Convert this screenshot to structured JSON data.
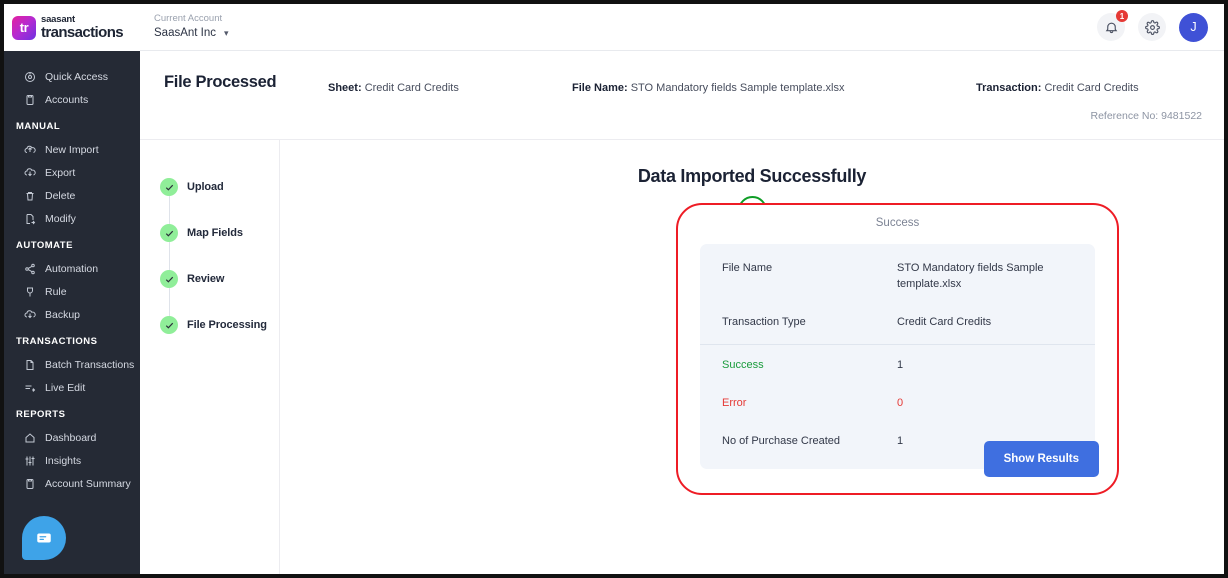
{
  "brand": {
    "mark_text": "tr",
    "name_top": "saasant",
    "name_bottom": "transactions",
    "mark_gradient_from": "#e5219e",
    "mark_gradient_to": "#6c31e0"
  },
  "topbar": {
    "account_label": "Current Account",
    "account_name": "SaasAnt Inc",
    "notification_count": "1",
    "avatar_initial": "J"
  },
  "sidebar": {
    "top_items": [
      {
        "label": "Quick Access",
        "icon": "target-icon"
      },
      {
        "label": "Accounts",
        "icon": "clipboard-icon"
      }
    ],
    "sections": [
      {
        "title": "MANUAL",
        "items": [
          {
            "label": "New Import",
            "icon": "upload-cloud-icon"
          },
          {
            "label": "Export",
            "icon": "download-cloud-icon"
          },
          {
            "label": "Delete",
            "icon": "trash-icon"
          },
          {
            "label": "Modify",
            "icon": "file-edit-icon"
          }
        ]
      },
      {
        "title": "AUTOMATE",
        "items": [
          {
            "label": "Automation",
            "icon": "share-nodes-icon"
          },
          {
            "label": "Rule",
            "icon": "rule-icon"
          },
          {
            "label": "Backup",
            "icon": "backup-cloud-icon"
          }
        ]
      },
      {
        "title": "TRANSACTIONS",
        "items": [
          {
            "label": "Batch Transactions",
            "icon": "document-icon"
          },
          {
            "label": "Live Edit",
            "icon": "live-edit-icon"
          }
        ]
      },
      {
        "title": "REPORTS",
        "items": [
          {
            "label": "Dashboard",
            "icon": "home-icon"
          },
          {
            "label": "Insights",
            "icon": "sliders-icon"
          },
          {
            "label": "Account Summary",
            "icon": "clipboard-icon"
          }
        ]
      }
    ],
    "chat_icon": "chat-bubble-icon"
  },
  "page_header": {
    "title": "File Processed",
    "sheet_label": "Sheet:",
    "sheet_value": "Credit Card Credits",
    "file_label": "File Name:",
    "file_value": "STO Mandatory fields Sample template.xlsx",
    "transaction_label": "Transaction:",
    "transaction_value": "Credit Card Credits",
    "reference": "Reference No: 9481522"
  },
  "stepper": {
    "steps": [
      {
        "label": "Upload",
        "state": "complete"
      },
      {
        "label": "Map Fields",
        "state": "complete"
      },
      {
        "label": "Review",
        "state": "complete"
      },
      {
        "label": "File Processing",
        "state": "complete"
      }
    ]
  },
  "result": {
    "heading": "Data Imported Successfully",
    "status_icon": "check-circle-icon",
    "panel_label": "Success",
    "rows": [
      {
        "key": "File Name",
        "value": "STO Mandatory fields Sample template.xlsx",
        "tone": "default"
      },
      {
        "key": "Transaction Type",
        "value": "Credit Card Credits",
        "tone": "default"
      },
      {
        "key": "Success",
        "value": "1",
        "tone": "green"
      },
      {
        "key": "Error",
        "value": "0",
        "tone": "red"
      },
      {
        "key": "No of Purchase Created",
        "value": "1",
        "tone": "default"
      }
    ],
    "show_results_label": "Show Results",
    "highlight_color": "#ee1c25",
    "button_color": "#3f6fe0",
    "success_color": "#1a9c3c",
    "error_color": "#e53935"
  }
}
